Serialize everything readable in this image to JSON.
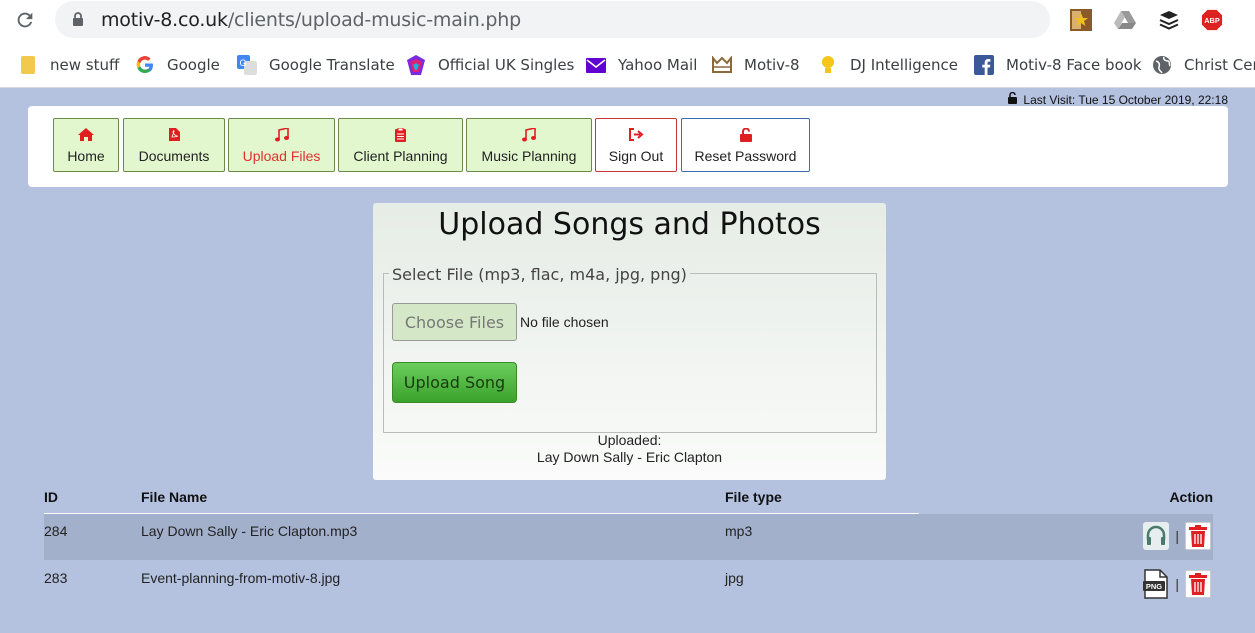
{
  "browser": {
    "url_host": "motiv-8.co.uk",
    "url_path": "/clients/upload-music-main.php",
    "bookmarks": [
      {
        "label": "new stuff",
        "icon": "folder-icon"
      },
      {
        "label": "Google",
        "icon": "google-icon"
      },
      {
        "label": "Google Translate",
        "icon": "google-translate-icon"
      },
      {
        "label": "Official UK Singles",
        "icon": "official-charts-icon"
      },
      {
        "label": "Yahoo Mail",
        "icon": "yahoo-mail-icon"
      },
      {
        "label": "Motiv-8",
        "icon": "motiv8-icon"
      },
      {
        "label": "DJ Intelligence",
        "icon": "lightbulb-icon"
      },
      {
        "label": "Motiv-8 Face book",
        "icon": "facebook-icon"
      },
      {
        "label": "Christ Cen",
        "icon": "globe-icon"
      }
    ],
    "extensions": [
      "star-ext-icon",
      "google-drive-icon",
      "buffer-icon",
      "adblock-plus-icon"
    ],
    "abp_label": "ABP"
  },
  "header": {
    "last_visit": "Last Visit: Tue 15 October 2019, 22:18"
  },
  "nav": {
    "items": [
      {
        "label": "Home",
        "icon": "home-icon"
      },
      {
        "label": "Documents",
        "icon": "pdf-icon"
      },
      {
        "label": "Upload Files",
        "icon": "music-note-icon",
        "active": true
      },
      {
        "label": "Client Planning",
        "icon": "clipboard-icon"
      },
      {
        "label": "Music Planning",
        "icon": "music-note-icon"
      },
      {
        "label": "Sign Out",
        "icon": "sign-out-icon"
      },
      {
        "label": "Reset Password",
        "icon": "unlock-icon"
      }
    ]
  },
  "upload": {
    "title": "Upload Songs and Photos",
    "legend": "Select File (mp3, flac, m4a, jpg, png)",
    "choose_label": "Choose Files",
    "no_file": "No file chosen",
    "upload_label": "Upload Song",
    "uploaded_heading": "Uploaded:",
    "uploaded_file": "Lay Down Sally - Eric Clapton"
  },
  "table": {
    "headers": {
      "id": "ID",
      "file_name": "File Name",
      "file_type": "File type",
      "action": "Action"
    },
    "separator": "|",
    "rows": [
      {
        "id": "284",
        "file_name": "Lay Down Sally - Eric Clapton.mp3",
        "file_type": "mp3",
        "preview_icon": "headphones-icon"
      },
      {
        "id": "283",
        "file_name": "Event-planning-from-motiv-8.jpg",
        "file_type": "jpg",
        "preview_icon": "png-file-icon"
      }
    ]
  },
  "colors": {
    "page_bg": "#b4c1df",
    "nav_button_bg": "#e3f7cf",
    "accent_red": "#e03030",
    "upload_green": "#3ba32c"
  }
}
